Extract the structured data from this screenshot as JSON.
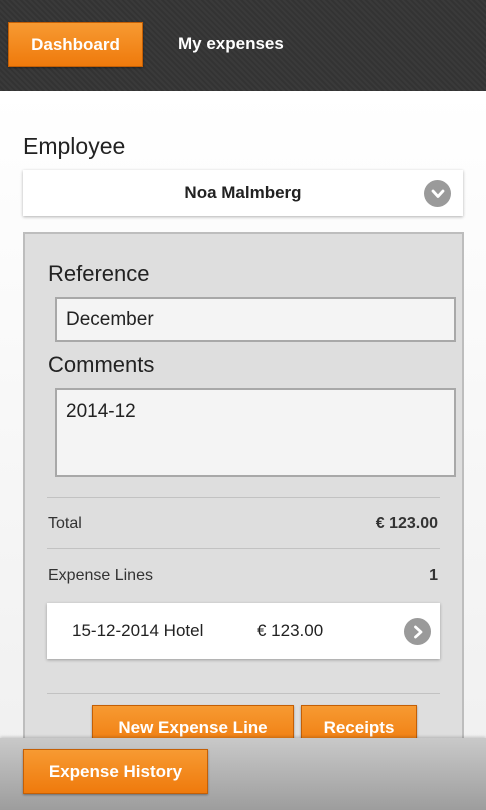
{
  "header": {
    "dashboard_label": "Dashboard",
    "title": "My expenses"
  },
  "employee": {
    "label": "Employee",
    "selected": "Noa Malmberg"
  },
  "form": {
    "reference_label": "Reference",
    "reference_value": "December",
    "comments_label": "Comments",
    "comments_value": "2014-12",
    "total_label": "Total",
    "total_value": "€ 123.00",
    "lines_label": "Expense Lines",
    "lines_count": "1"
  },
  "expense_lines": [
    {
      "date": "15-12-2014 Hotel",
      "amount": "€ 123.00"
    }
  ],
  "actions": {
    "new_line_label": "New Expense Line",
    "receipts_label": "Receipts"
  },
  "footer": {
    "history_label": "Expense History"
  },
  "icons": {
    "employee_dropdown": "chevron-down-icon",
    "expense_line_open": "chevron-right-icon"
  },
  "colors": {
    "accent": "#f08a1e",
    "header_bg": "#333333",
    "icon_gray": "#9a9a9a"
  }
}
